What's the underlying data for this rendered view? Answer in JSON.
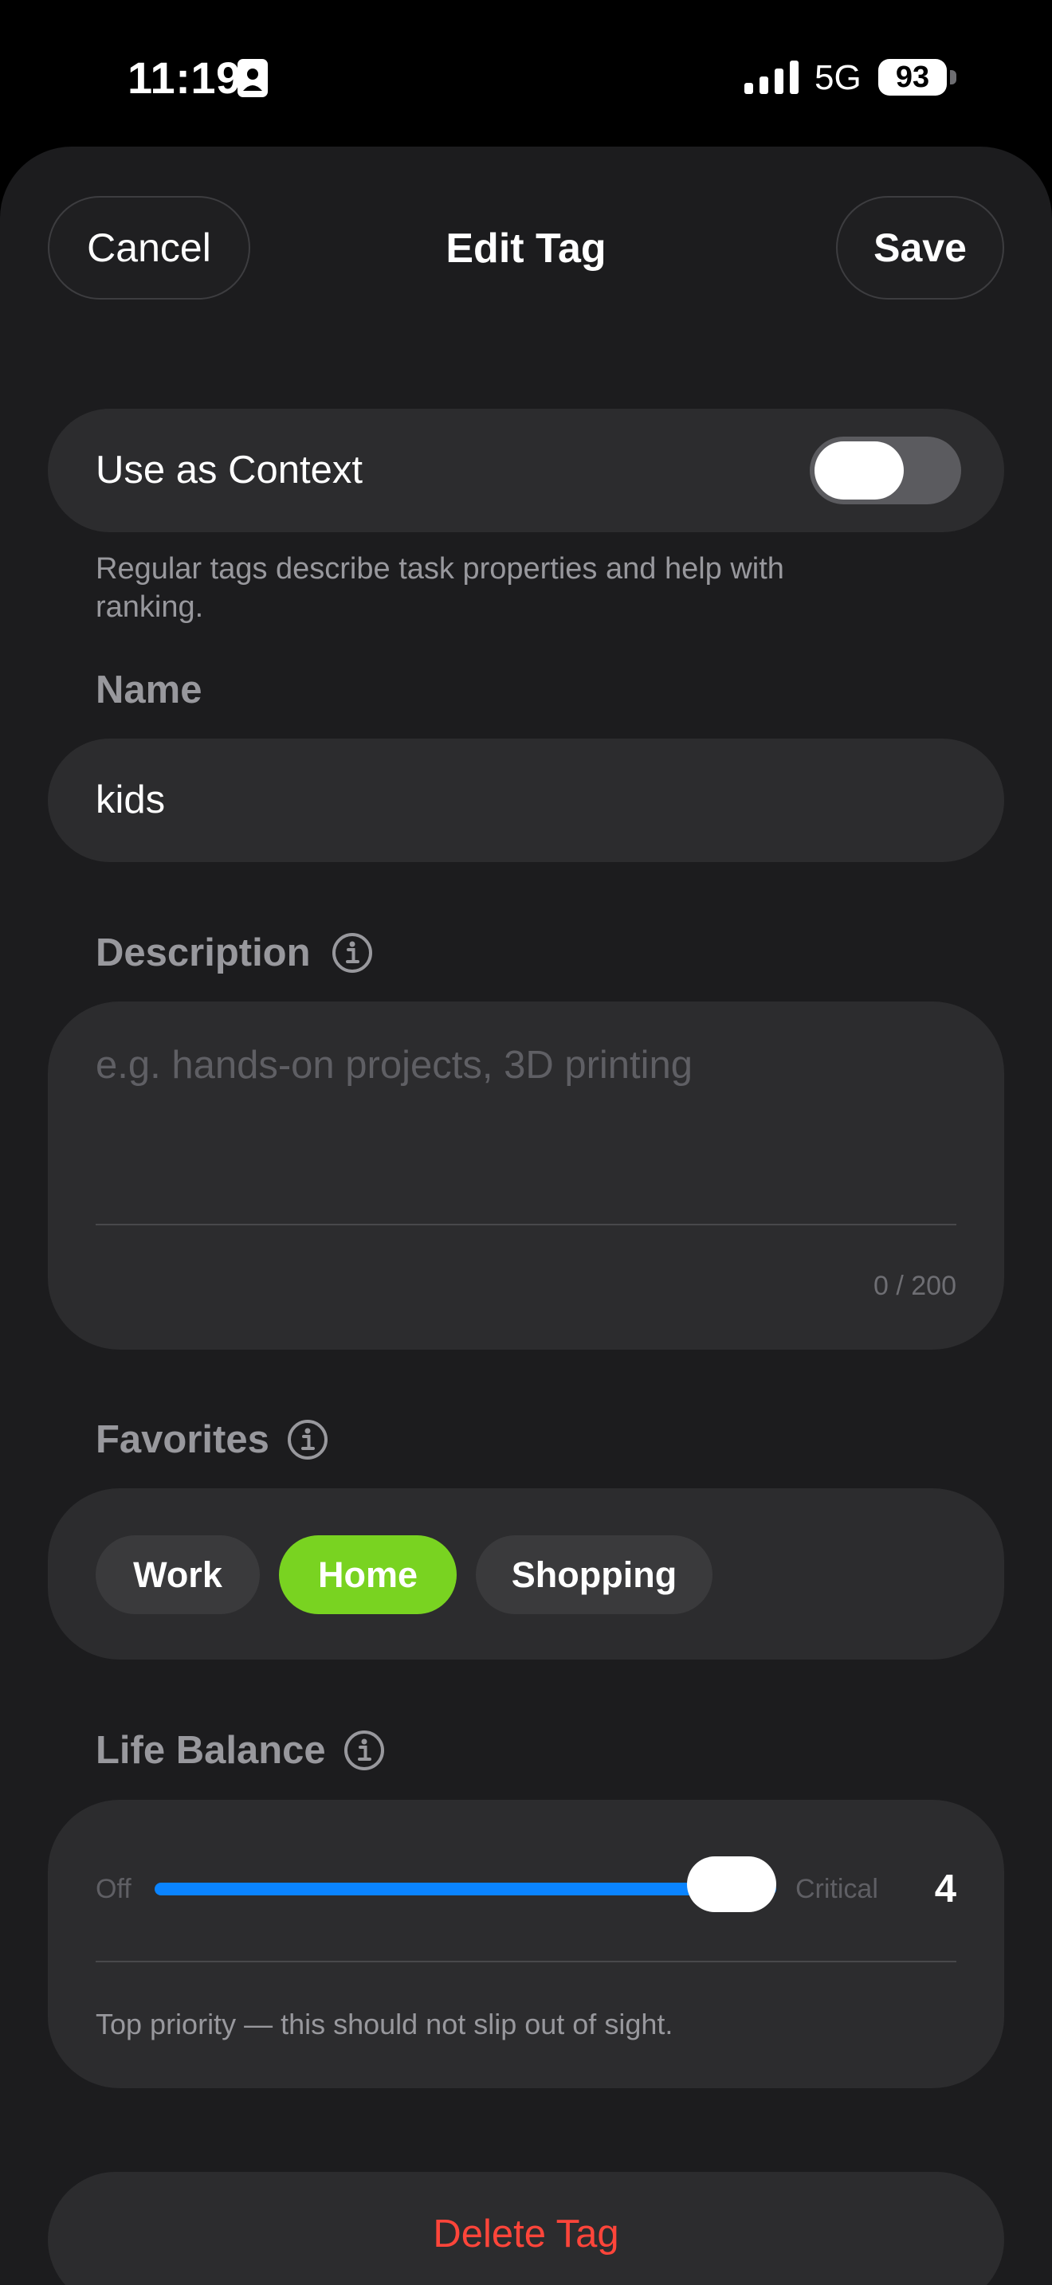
{
  "status_bar": {
    "time": "11:19",
    "network": "5G",
    "battery": "93",
    "icons": [
      "id-badge-icon",
      "cellular-signal-icon",
      "battery-icon"
    ]
  },
  "header": {
    "cancel_label": "Cancel",
    "title": "Edit Tag",
    "save_label": "Save"
  },
  "context": {
    "label": "Use as Context",
    "enabled": false,
    "help": "Regular tags describe task properties and help with ranking."
  },
  "name": {
    "label": "Name",
    "value": "kids"
  },
  "description": {
    "label": "Description",
    "placeholder": "e.g. hands-on projects, 3D printing",
    "value": "",
    "counter": "0 / 200"
  },
  "favorites": {
    "label": "Favorites",
    "chips": [
      {
        "label": "Work",
        "selected": false
      },
      {
        "label": "Home",
        "selected": true
      },
      {
        "label": "Shopping",
        "selected": false
      }
    ]
  },
  "life_balance": {
    "label": "Life Balance",
    "min_label": "Off",
    "max_label": "Critical",
    "value": "4",
    "slider_fraction": 1.0,
    "description": "Top priority — this should not slip out of sight."
  },
  "delete_label": "Delete Tag",
  "colors": {
    "accent_blue": "#0a84ff",
    "selected_chip": "#79d321",
    "destructive": "#ff453a",
    "background": "#1c1c1e",
    "card": "#2c2c2e"
  }
}
